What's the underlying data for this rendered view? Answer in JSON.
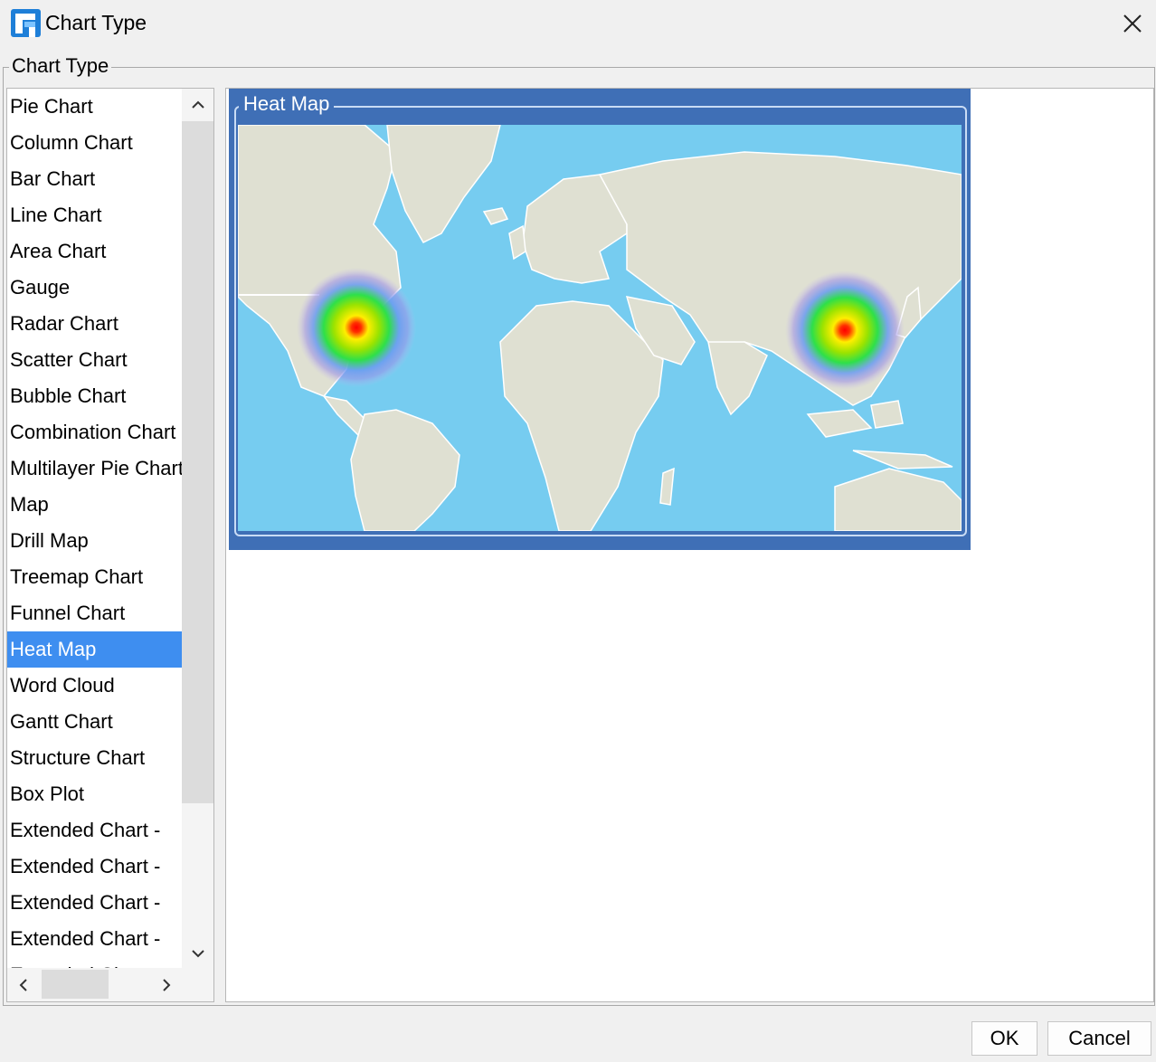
{
  "window": {
    "title": "Chart Type",
    "icon": "finereport-logo-icon",
    "close_icon": "close-icon"
  },
  "group": {
    "legend": "Chart Type"
  },
  "chart_types": [
    "Pie Chart",
    "Column Chart",
    "Bar Chart",
    "Line Chart",
    "Area Chart",
    "Gauge",
    "Radar Chart",
    "Scatter Chart",
    "Bubble Chart",
    "Combination Chart",
    "Multilayer Pie Chart",
    "Map",
    "Drill Map",
    "Treemap Chart",
    "Funnel Chart",
    "Heat Map",
    "Word Cloud",
    "Gantt Chart",
    "Structure Chart",
    "Box Plot",
    "Extended Chart -",
    "Extended Chart -",
    "Extended Chart -",
    "Extended Chart -",
    "Extended Chart -"
  ],
  "selected_index": 15,
  "preview": {
    "label": "Heat Map",
    "colors": {
      "ocean": "#76ccf0",
      "land": "#dfe0d2",
      "frame": "#3f6fb6"
    }
  },
  "buttons": {
    "ok": "OK",
    "cancel": "Cancel"
  },
  "colors": {
    "selection": "#3e8ef0",
    "background": "#f0f0f0"
  }
}
